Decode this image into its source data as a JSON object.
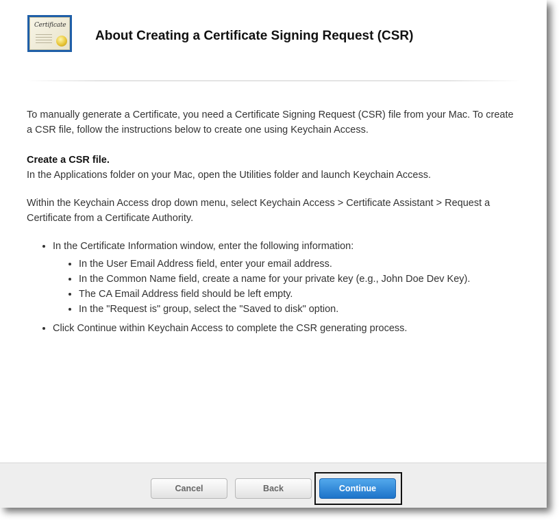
{
  "dialog": {
    "title": "About Creating a Certificate Signing Request (CSR)",
    "icon_text": "Certificate"
  },
  "content": {
    "intro": "To manually generate a Certificate, you need a Certificate Signing Request (CSR) file from your Mac. To create a CSR file, follow the instructions below to create one using Keychain Access.",
    "section_heading": "Create a CSR file.",
    "step1": "In the Applications folder on your Mac, open the Utilities folder and launch Keychain Access.",
    "step2": "Within the Keychain Access drop down menu, select Keychain Access > Certificate Assistant > Request a Certificate from a Certificate Authority.",
    "bullets": [
      {
        "text": "In the Certificate Information window, enter the following information:",
        "sub": [
          "In the User Email Address field, enter your email address.",
          "In the Common Name field, create a name for your private key (e.g., John Doe Dev Key).",
          "The CA Email Address field should be left empty.",
          "In the \"Request is\" group, select the \"Saved to disk\" option."
        ]
      },
      {
        "text": "Click Continue within Keychain Access to complete the CSR generating process."
      }
    ]
  },
  "footer": {
    "cancel_label": "Cancel",
    "back_label": "Back",
    "continue_label": "Continue"
  },
  "colors": {
    "primary_button": "#1d73c9",
    "secondary_button": "#e2e2e2",
    "footer_bg": "#eeeeee",
    "focus_ring": "#111111"
  },
  "icons": {
    "header_icon": "certificate-icon"
  }
}
